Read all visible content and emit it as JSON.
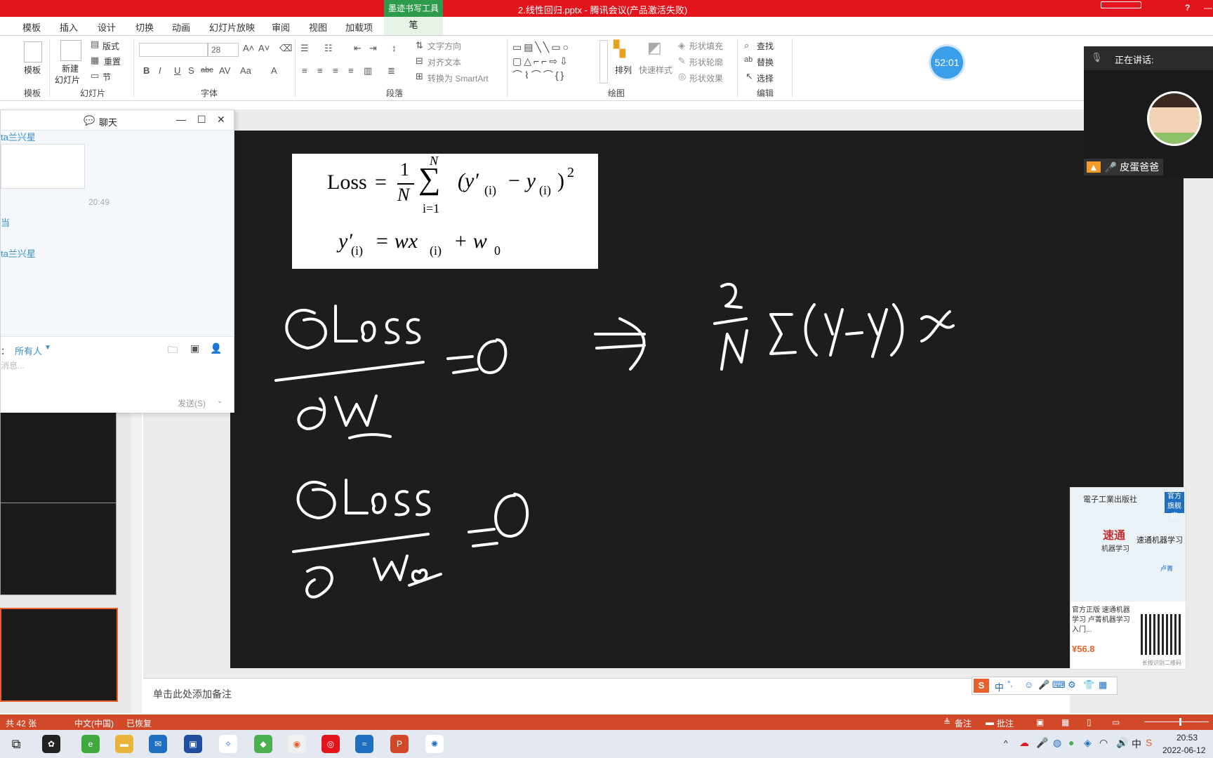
{
  "window": {
    "title": "2.线性回归.pptx - 腾讯会议(产品激活失败)",
    "ink_tools_tab": "墨迹书写工具",
    "help": "?"
  },
  "ribbon_tabs": [
    "模板",
    "插入",
    "设计",
    "切换",
    "动画",
    "幻灯片放映",
    "审阅",
    "视图",
    "加载项"
  ],
  "pen_tab": "笔",
  "ribbon": {
    "template_btn": "模板",
    "new_slide_line1": "新建",
    "new_slide_line2": "幻灯片",
    "layout": "版式",
    "reset": "重置",
    "section": "节",
    "font_size": "28",
    "text_direction": "文字方向",
    "align_text": "对齐文本",
    "convert_smartart": "转换为 SmartArt",
    "arrange": "排列",
    "quick_styles": "快速样式",
    "shape_fill": "形状填充",
    "shape_outline": "形状轮廓",
    "shape_effects": "形状效果",
    "find": "查找",
    "replace": "替换",
    "select": "选择",
    "groups": {
      "template": "模板",
      "slides": "幻灯片",
      "font": "字体",
      "paragraph": "段落",
      "drawing": "绘图",
      "editing": "编辑"
    }
  },
  "timer": "52:01",
  "chat": {
    "title": "聊天",
    "sender1": "ta兰兴星",
    "time": "20:49",
    "snippet": "当",
    "sender2": "ta兰兴星",
    "recipient_label": "：",
    "recipient": "所有人",
    "input_placeholder": "消息...",
    "send": "发送(S)"
  },
  "formula": {
    "line1": "Loss = (1/N) Σ (y′(i) − y(i))²",
    "loss": "Loss",
    "eq": "=",
    "one": "1",
    "n": "N",
    "sigma": "∑",
    "sum_top": "N",
    "sum_bottom": "i=1",
    "term": "(y′",
    "sub_i1": "(i)",
    "minus": "− y",
    "sub_i2": "(i)",
    "close": ")",
    "sq": "2",
    "line2_y": "y′",
    "line2_sub": "(i)",
    "line2_eq": "= wx",
    "line2_sub2": "(i)",
    "line2_plus": "+ w",
    "line2_zero": "0"
  },
  "notes_placeholder": "单击此处添加备注",
  "video": {
    "speaking_label": "正在讲话:",
    "speaker_name": "皮蛋爸爸"
  },
  "ad": {
    "publisher": "電子工業出版社",
    "badge_line1": "官方",
    "badge_line2": "旗舰店",
    "book_title": "速通机器学习",
    "book_cn": "速通",
    "book_sub": "机器学习",
    "author": "卢菁",
    "description": "官方正版 速通机器学习 卢菁机器学习入门...",
    "price": "¥56.8",
    "qr_label": "长按识别二维码"
  },
  "ime": {
    "logo": "S",
    "lang": "中",
    "punct": "°,"
  },
  "status": {
    "slide_count": "共 42 张",
    "language": "中文(中国)",
    "recovered": "已恢复",
    "notes": "备注",
    "comments": "批注"
  },
  "taskbar": {
    "time": "20:53",
    "date": "2022-06-12"
  },
  "colors": {
    "titlebar": "#e3141b",
    "status": "#d2492a",
    "accent_green": "#2e9a4b",
    "chat_name": "#3a8ec7",
    "price": "#e8612c"
  }
}
